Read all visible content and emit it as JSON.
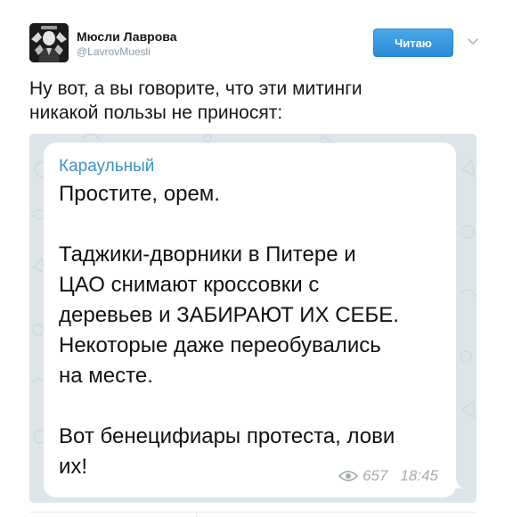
{
  "author": {
    "name": "Мюсли Лаврова",
    "handle": "@LavrovMuesli"
  },
  "follow_button": {
    "label": "Читаю"
  },
  "tweet": {
    "text": "Ну вот, а вы говорите, что эти митинги\nникакой пользы не приносят:"
  },
  "embedded_message": {
    "channel": "Караульный",
    "text": "Простите, орем.\n\nТаджики-дворники в Питере и\nЦАО снимают кроссовки с\nдеревьев и ЗАБИРАЮТ ИХ СЕБЕ.\nНекоторые даже переобувались\nна месте.\n\nВот бенецифиары протеста, лови\nих!",
    "views": "657",
    "time": "18:45"
  },
  "icons": {
    "more": "chevron-down-icon",
    "views": "eye-icon"
  },
  "colors": {
    "follow_button": "#2b8ad6",
    "channel_name": "#3f8fc7",
    "media_background": "#dfe6ea"
  }
}
